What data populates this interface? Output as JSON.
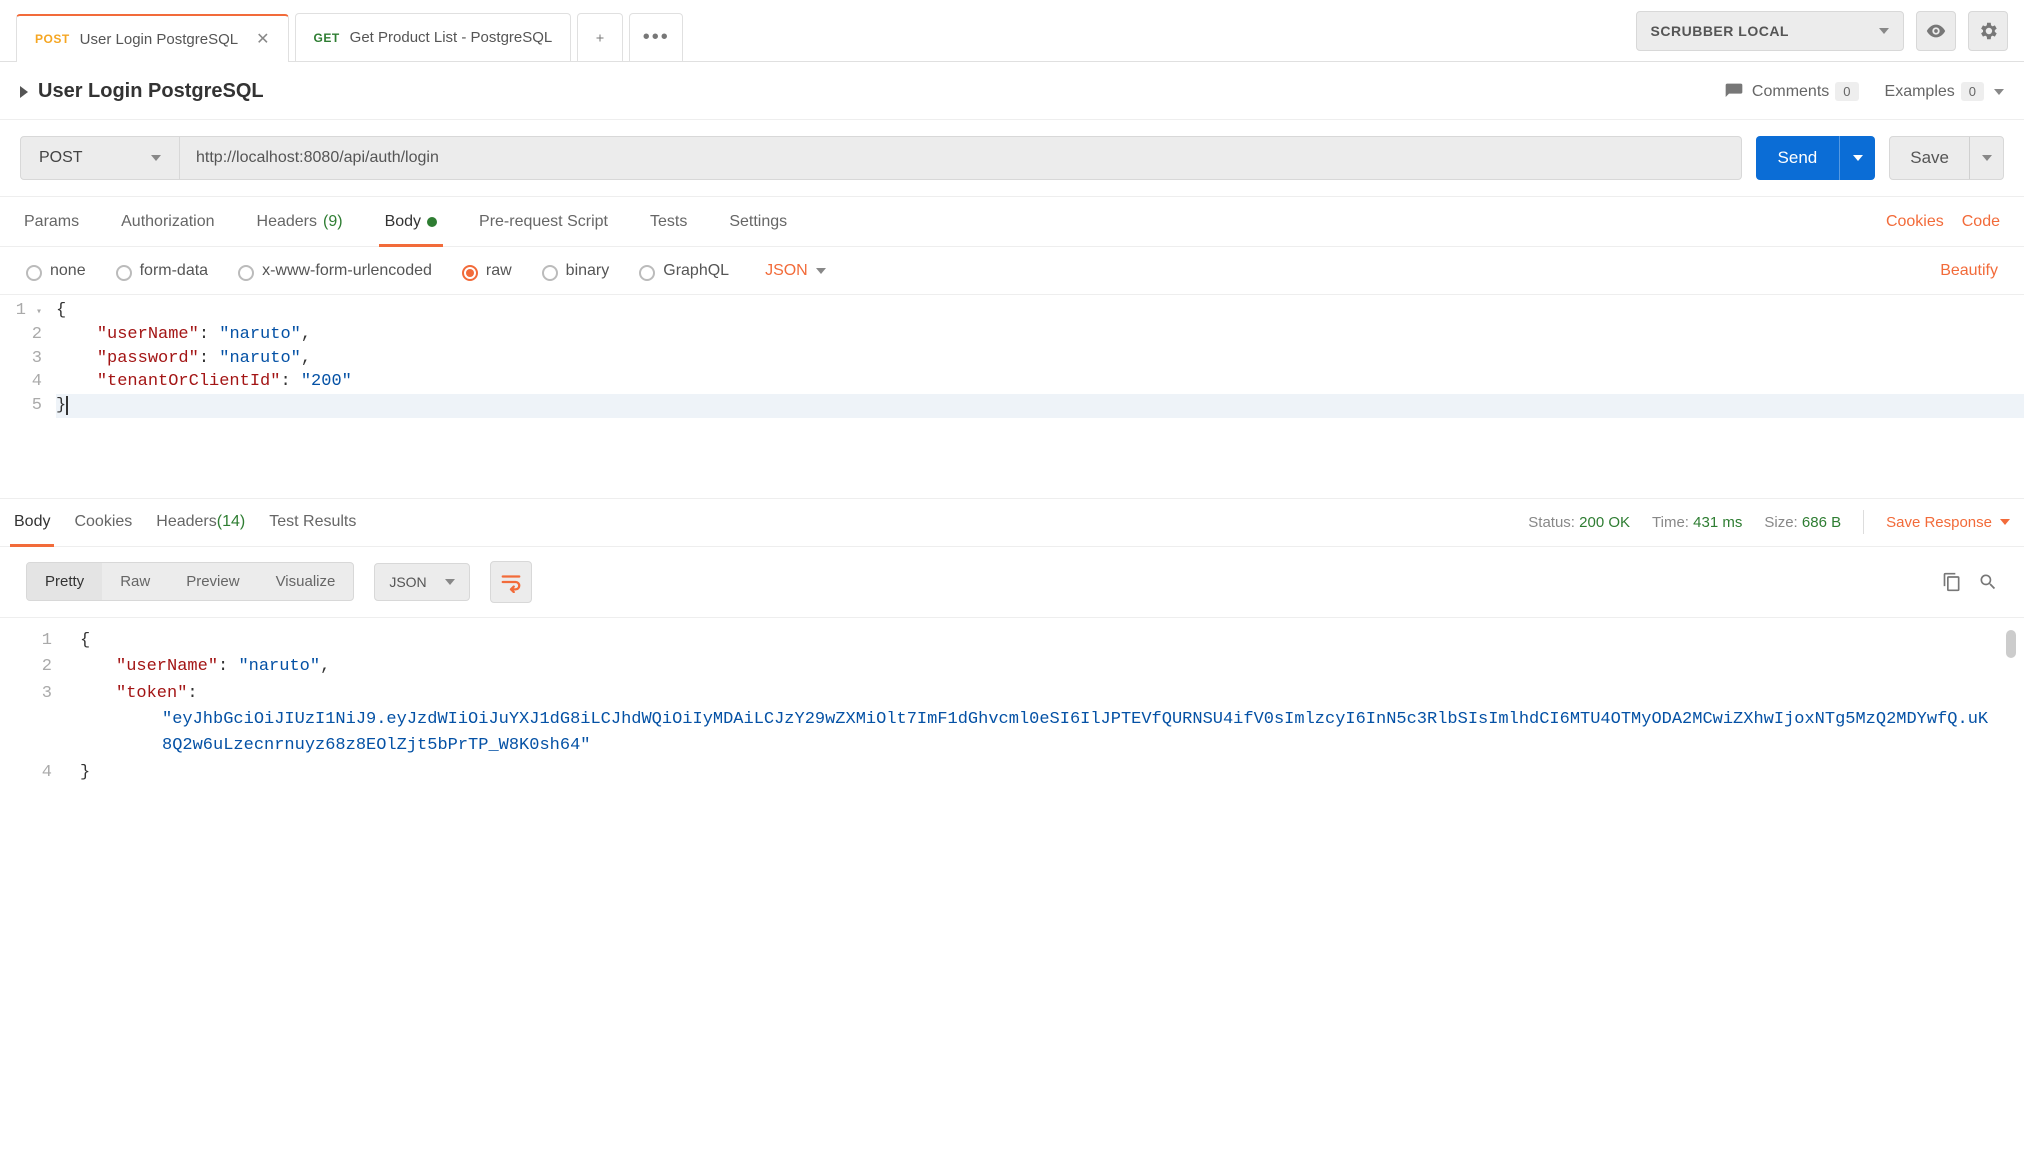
{
  "topbar": {
    "tabs": [
      {
        "method": "POST",
        "label": "User Login PostgreSQL",
        "active": true
      },
      {
        "method": "GET",
        "label": "Get Product List - PostgreSQL",
        "active": false
      }
    ],
    "env_selected": "SCRUBBER LOCAL"
  },
  "title": {
    "name": "User Login PostgreSQL",
    "comments_label": "Comments",
    "comments_count": "0",
    "examples_label": "Examples",
    "examples_count": "0"
  },
  "request": {
    "method": "POST",
    "url": "http://localhost:8080/api/auth/login",
    "send_label": "Send",
    "save_label": "Save"
  },
  "req_tabs": {
    "params": "Params",
    "auth": "Authorization",
    "headers": "Headers",
    "headers_count": "(9)",
    "body": "Body",
    "prerequest": "Pre-request Script",
    "tests": "Tests",
    "settings": "Settings",
    "cookies": "Cookies",
    "code": "Code"
  },
  "body_types": {
    "none": "none",
    "form": "form-data",
    "urlencoded": "x-www-form-urlencoded",
    "raw": "raw",
    "binary": "binary",
    "graphql": "GraphQL",
    "format": "JSON",
    "beautify": "Beautify"
  },
  "request_body": {
    "l1": "{",
    "l2a": "\"userName\"",
    "l2b": "\"naruto\"",
    "l3a": "\"password\"",
    "l3b": "\"naruto\"",
    "l4a": "\"tenantOrClientId\"",
    "l4b": "\"200\"",
    "l5": "}"
  },
  "response_header": {
    "body": "Body",
    "cookies": "Cookies",
    "headers": "Headers",
    "headers_count": "(14)",
    "testresults": "Test Results",
    "status_label": "Status:",
    "status_value": "200 OK",
    "time_label": "Time:",
    "time_value": "431 ms",
    "size_label": "Size:",
    "size_value": "686 B",
    "save_response": "Save Response"
  },
  "response_tools": {
    "pretty": "Pretty",
    "raw": "Raw",
    "preview": "Preview",
    "visualize": "Visualize",
    "format": "JSON"
  },
  "response_body": {
    "l1": "{",
    "l2a": "\"userName\"",
    "l2b": "\"naruto\"",
    "l3a": "\"token\"",
    "token_value": "\"eyJhbGciOiJIUzI1NiJ9.eyJzdWIiOiJuYXJ1dG8iLCJhdWQiOiIyMDAiLCJzY29wZXMiOlt7ImF1dGhvcml0eSI6IlJPTEVfQURNSU4ifV0sImlzcyI6InN5c3RlbSIsImlhdCI6MTU4OTMyODA2MCwiZXhwIjoxNTg5MzQ2MDYwfQ.uK8Q2w6uLzecnrnuyz68z8EOlZjt5bPrTP_W8K0sh64\"",
    "l4": "}"
  }
}
